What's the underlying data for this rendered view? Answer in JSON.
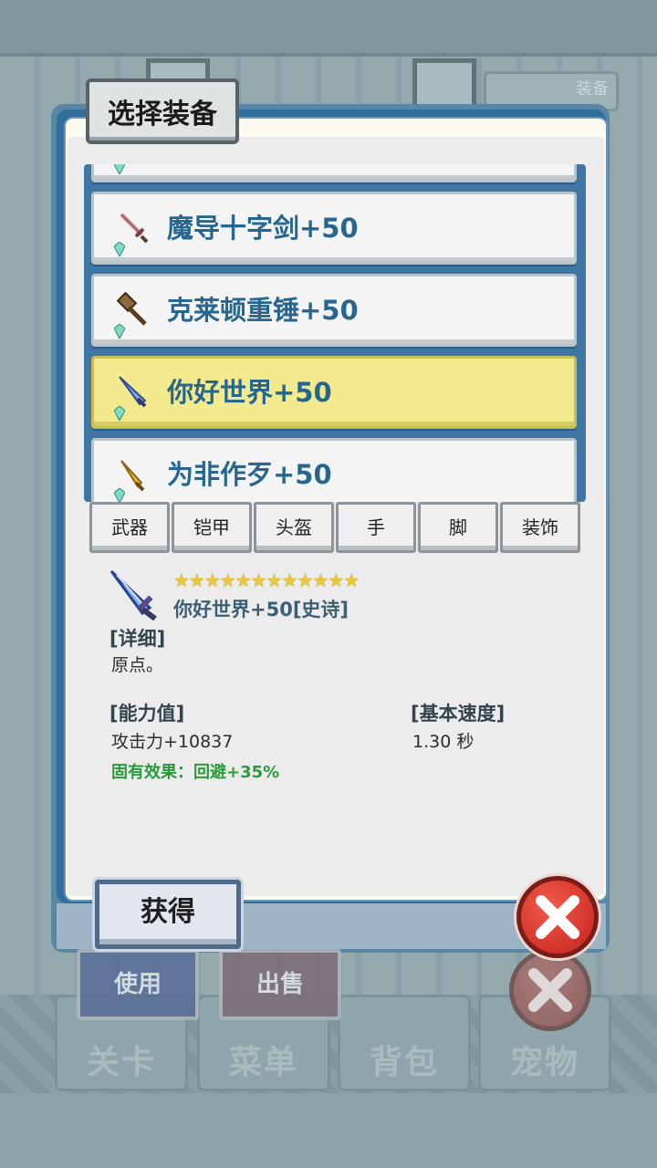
{
  "background": {
    "bottom_tabs": [
      "关卡",
      "菜单",
      "背包",
      "宠物"
    ],
    "gold_button": "装备"
  },
  "dialog": {
    "title": "选择装备"
  },
  "equipment_list": {
    "items": [
      {
        "label": "魔导十字剑+50",
        "icon": "sword-icon",
        "selected": false
      },
      {
        "label": "克莱顿重锤+50",
        "icon": "hammer-icon",
        "selected": false
      },
      {
        "label": "你好世界+50",
        "icon": "blue-blade-icon",
        "selected": true
      },
      {
        "label": "为非作歹+50",
        "icon": "gold-dagger-icon",
        "selected": false
      }
    ]
  },
  "categories": [
    "武器",
    "铠甲",
    "头盔",
    "手",
    "脚",
    "装饰"
  ],
  "detail": {
    "stars": "★★★★★★★★★★★★",
    "star_count": 12,
    "name": "你好世界+50[史诗]",
    "detail_heading": "[详细]",
    "detail_text": "原点。",
    "ability_heading": "[能力值]",
    "ability_value": "攻击力+10837",
    "speed_heading": "[基本速度]",
    "speed_value": "1.30 秒",
    "effect": "固有效果：回避+35%"
  },
  "buttons": {
    "obtain": "获得",
    "use": "使用",
    "sell": "出售"
  },
  "colors": {
    "panel_border": "#2f6f9d",
    "selected_item": "#f2ea8c",
    "item_text": "#27668f",
    "effect_text": "#2a9a3a",
    "close_button": "#d9302a"
  }
}
